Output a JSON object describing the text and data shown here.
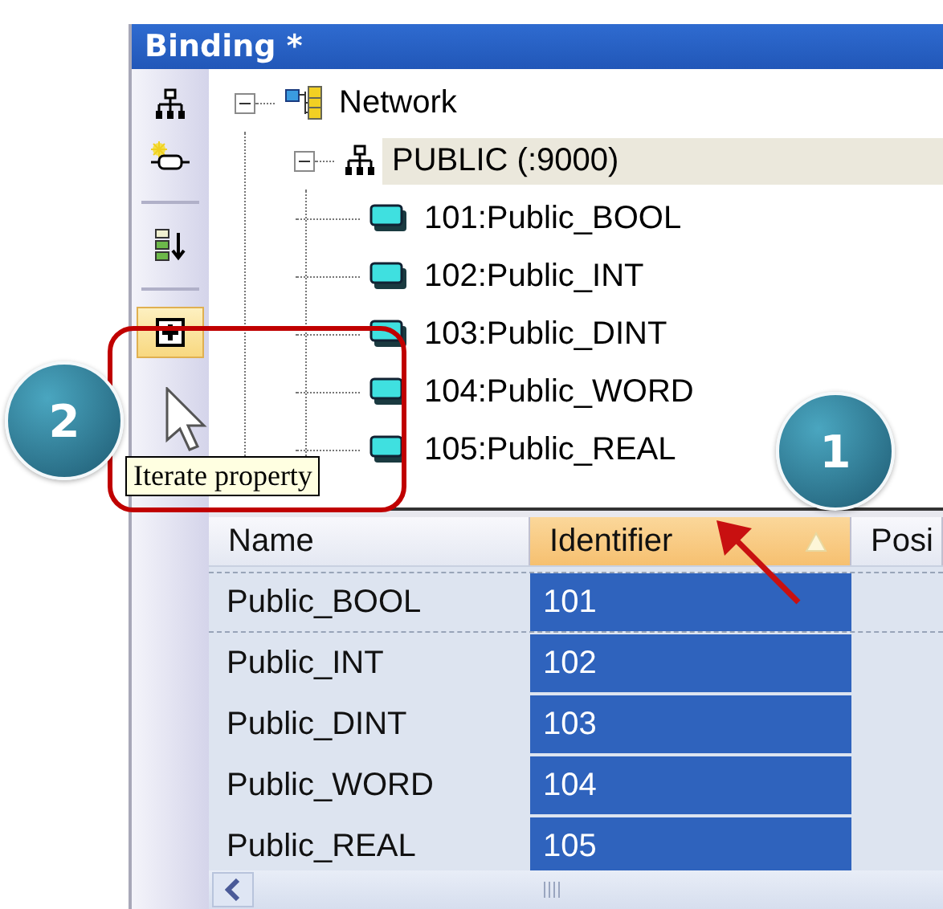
{
  "window": {
    "title": "Binding *"
  },
  "toolbar": [
    {
      "kind": "network",
      "highlighted": false
    },
    {
      "kind": "connect",
      "highlighted": false
    },
    {
      "kind": "separator"
    },
    {
      "kind": "sort",
      "highlighted": false
    },
    {
      "kind": "separator"
    },
    {
      "kind": "add",
      "highlighted": true
    }
  ],
  "tree": [
    {
      "label": "Network",
      "kind": "root",
      "expanded": true,
      "selected": false,
      "children": [
        {
          "label": "PUBLIC (:9000)",
          "kind": "channel",
          "expanded": true,
          "selected": true,
          "children": [
            {
              "label": "101:Public_BOOL",
              "kind": "variable",
              "selected": false
            },
            {
              "label": "102:Public_INT",
              "kind": "variable",
              "selected": false
            },
            {
              "label": "103:Public_DINT",
              "kind": "variable",
              "selected": false
            },
            {
              "label": "104:Public_WORD",
              "kind": "variable",
              "selected": false
            },
            {
              "label": "105:Public_REAL",
              "kind": "variable",
              "selected": false
            }
          ]
        }
      ]
    }
  ],
  "grid": {
    "columns": [
      {
        "label": "Name",
        "selected": false
      },
      {
        "label": "Identifier",
        "selected": true
      },
      {
        "label": "Posi",
        "selected": false
      }
    ],
    "rows": [
      {
        "cells": [
          "Public_BOOL",
          "101"
        ],
        "focused": true
      },
      {
        "cells": [
          "Public_INT",
          "102"
        ],
        "focused": false
      },
      {
        "cells": [
          "Public_DINT",
          "103"
        ],
        "focused": false
      },
      {
        "cells": [
          "Public_WORD",
          "104"
        ],
        "focused": false
      },
      {
        "cells": [
          "Public_REAL",
          "105"
        ],
        "focused": false
      }
    ]
  },
  "tooltip": {
    "text": "Iterate property"
  },
  "callouts": [
    {
      "label": "2"
    },
    {
      "label": "1"
    }
  ]
}
